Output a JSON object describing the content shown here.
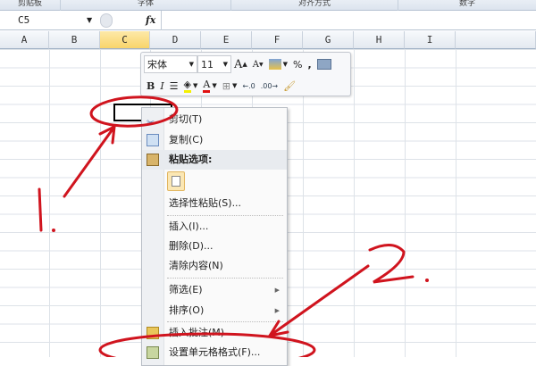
{
  "ribbon": {
    "groups": [
      "剪贴板",
      "字体",
      "对齐方式",
      "数字"
    ]
  },
  "formula_bar": {
    "name_box": "C5",
    "fx_label": "fx",
    "formula": ""
  },
  "columns": [
    "A",
    "B",
    "C",
    "D",
    "E",
    "F",
    "G",
    "H",
    "I"
  ],
  "selected_cell": "C5",
  "mini_toolbar": {
    "font_name": "宋体",
    "font_size": "11",
    "bold": "B",
    "italic": "I",
    "percent": "%",
    "comma": ",",
    "font_color_letter": "A",
    "grow_font": "A",
    "shrink_font": "A"
  },
  "context_menu": {
    "items": [
      {
        "label": "剪切(T)",
        "icon": "scissors-icon"
      },
      {
        "label": "复制(C)",
        "icon": "copy-icon"
      },
      {
        "label": "粘贴选项:",
        "icon": "paste-icon"
      },
      {
        "label": "选择性粘贴(S)..."
      },
      {
        "label": "插入(I)..."
      },
      {
        "label": "删除(D)..."
      },
      {
        "label": "清除内容(N)"
      },
      {
        "label": "筛选(E)",
        "submenu": true
      },
      {
        "label": "排序(O)",
        "submenu": true
      },
      {
        "label": "插入批注(M)",
        "icon": "comment-icon"
      },
      {
        "label": "设置单元格格式(F)...",
        "icon": "format-cells-icon"
      }
    ]
  },
  "annotations": {
    "step1": "1.",
    "step2": "2.",
    "color": "#d0141e"
  }
}
